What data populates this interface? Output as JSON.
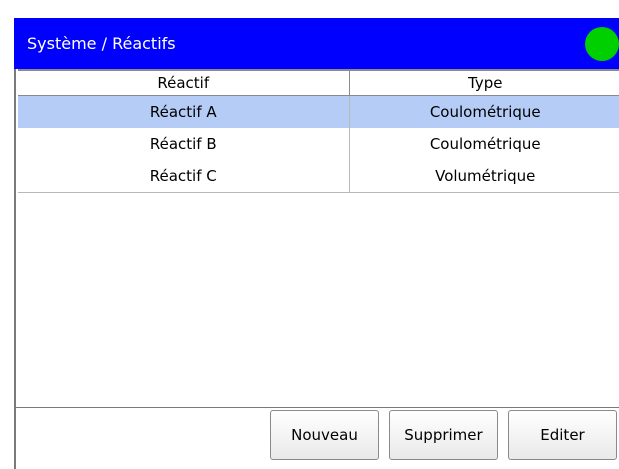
{
  "header": {
    "title": "Système / Réactifs",
    "status_color": "#00d000"
  },
  "table": {
    "columns": [
      "Réactif",
      "Type"
    ],
    "rows": [
      {
        "name": "Réactif A",
        "type": "Coulométrique",
        "selected": true
      },
      {
        "name": "Réactif B",
        "type": "Coulométrique",
        "selected": false
      },
      {
        "name": "Réactif C",
        "type": "Volumétrique",
        "selected": false
      }
    ]
  },
  "buttons": {
    "new": "Nouveau",
    "delete": "Supprimer",
    "edit": "Editer"
  },
  "colors": {
    "title_bar": "#0000ff",
    "selection": "#b4ccf6"
  }
}
